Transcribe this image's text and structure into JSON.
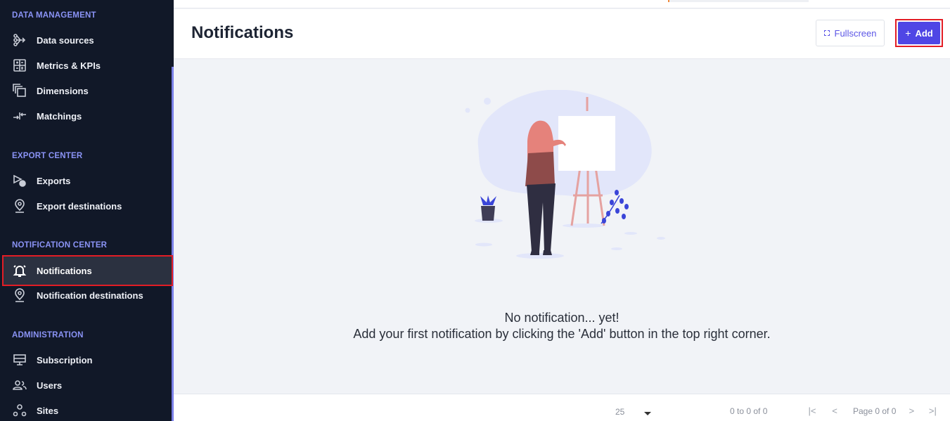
{
  "sidebar": {
    "sections": [
      {
        "title": "DATA MANAGEMENT"
      },
      {
        "title": "EXPORT CENTER"
      },
      {
        "title": "NOTIFICATION CENTER"
      },
      {
        "title": "ADMINISTRATION"
      }
    ],
    "items": [
      {
        "label": "Data sources",
        "icon": "data-sources-icon"
      },
      {
        "label": "Metrics & KPIs",
        "icon": "metrics-icon"
      },
      {
        "label": "Dimensions",
        "icon": "dimensions-icon"
      },
      {
        "label": "Matchings",
        "icon": "matchings-icon"
      },
      {
        "label": "Exports",
        "icon": "exports-icon"
      },
      {
        "label": "Export destinations",
        "icon": "location-pin-icon"
      },
      {
        "label": "Notifications",
        "icon": "bell-icon",
        "active": true
      },
      {
        "label": "Notification destinations",
        "icon": "location-pin-icon"
      },
      {
        "label": "Subscription",
        "icon": "subscription-icon"
      },
      {
        "label": "Users",
        "icon": "users-icon"
      },
      {
        "label": "Sites",
        "icon": "sites-icon"
      }
    ]
  },
  "header": {
    "title": "Notifications",
    "fullscreen_label": "Fullscreen",
    "add_label": "Add",
    "add_icon": "+"
  },
  "empty_state": {
    "line1": "No notification... yet!",
    "line2": "Add your first notification by clicking the 'Add' button in the top right corner."
  },
  "footer": {
    "page_size": "25",
    "range": "0 to 0 of 0",
    "page": "Page 0 of 0",
    "first": "|<",
    "prev": "<",
    "next": ">",
    "last": ">|"
  },
  "colors": {
    "sidebar_bg": "#111828",
    "accent": "#4f46e5",
    "section_title": "#8a93f5",
    "highlight_outline": "#e31d25"
  }
}
